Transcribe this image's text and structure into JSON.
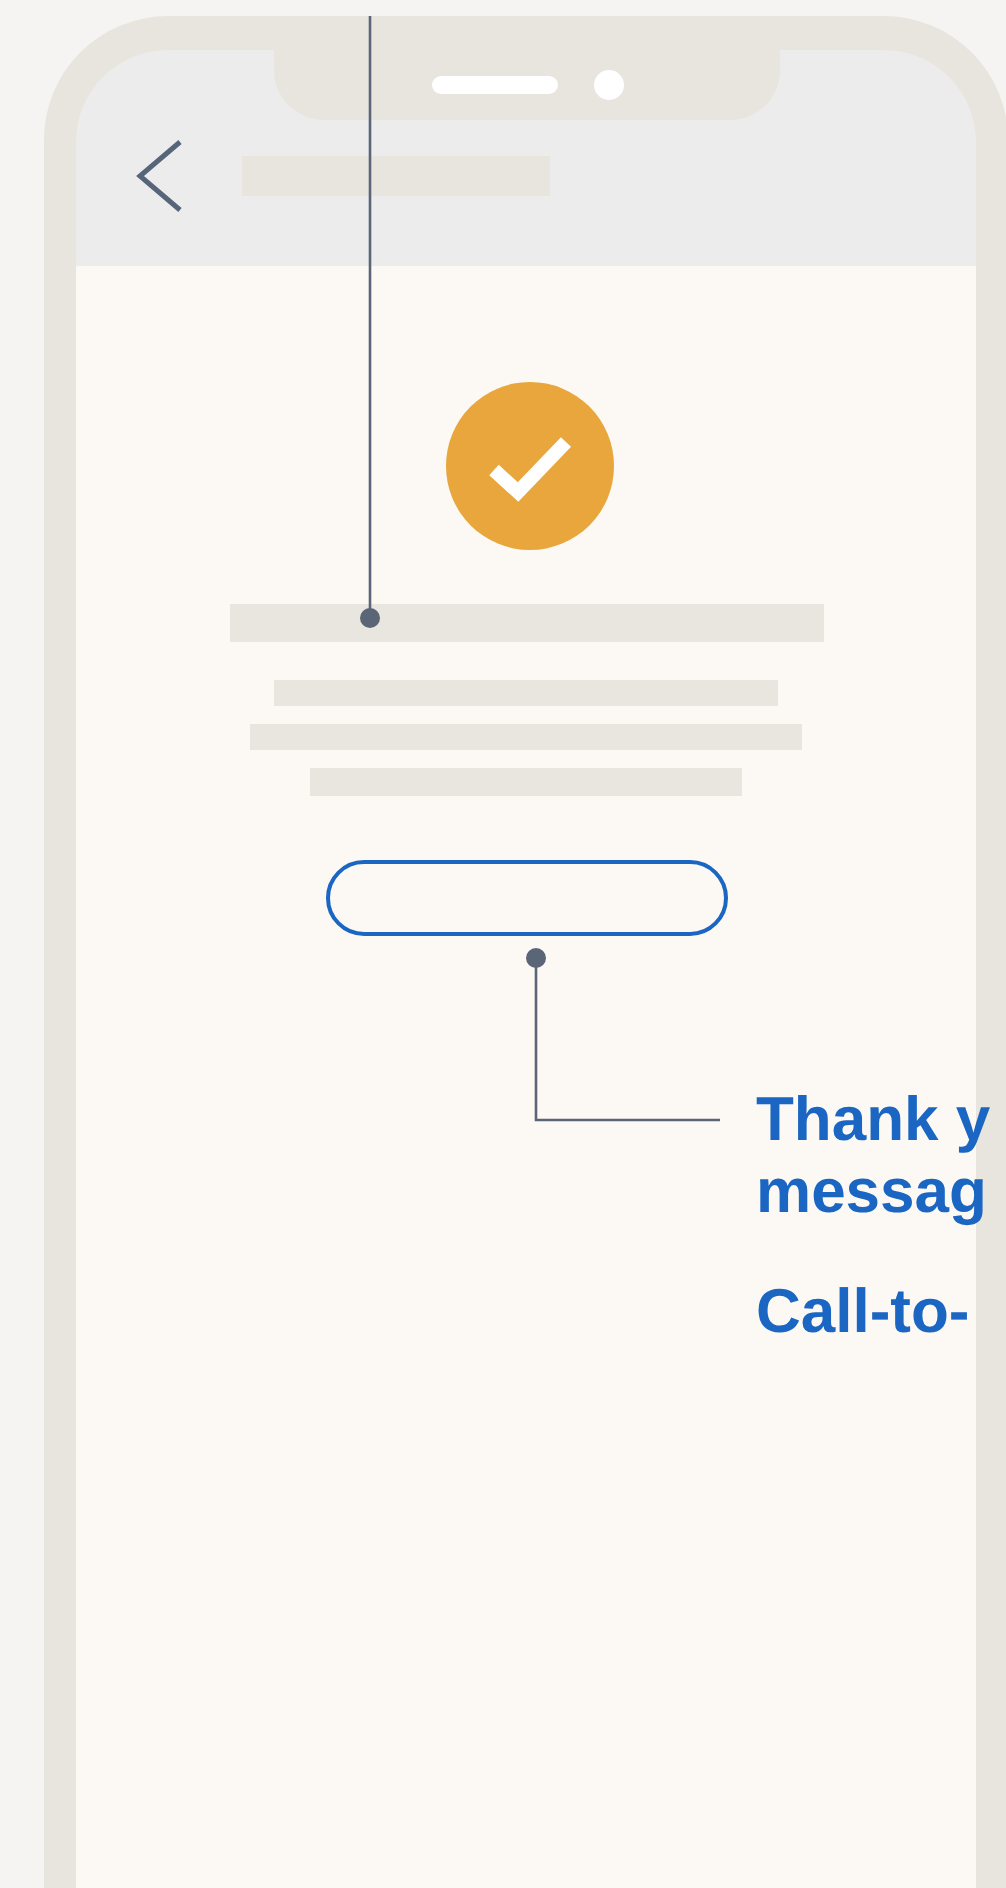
{
  "annotations": [
    {
      "lines": [
        "Thank y",
        "messag"
      ]
    },
    {
      "lines": [
        "Call-to-"
      ]
    }
  ]
}
